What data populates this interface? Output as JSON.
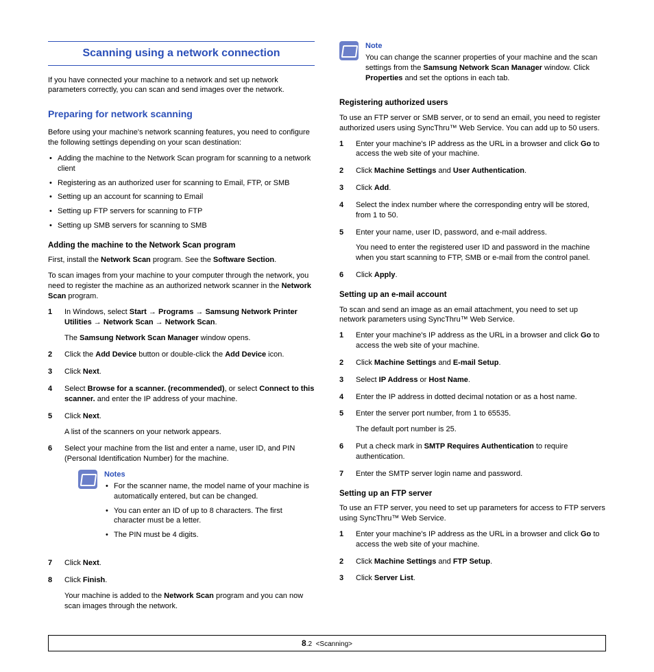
{
  "left": {
    "title": "Scanning using a network connection",
    "intro": "If you have connected your machine to a network and set up network parameters correctly, you can scan and send images over the network.",
    "prep_title": "Preparing for network scanning",
    "prep_intro": "Before using your machine's network scanning features, you need to configure the following settings depending on your scan destination:",
    "prep_bullets": [
      "Adding the machine to the Network Scan program for scanning to a network client",
      "Registering as an authorized user for scanning to Email, FTP, or SMB",
      "Setting up an account for scanning to Email",
      "Setting up FTP servers for scanning to FTP",
      "Setting up SMB servers for scanning to SMB"
    ],
    "add_title": "Adding the machine to the Network Scan program",
    "add_p1_a": "First, install the ",
    "add_p1_b": "Network Scan",
    "add_p1_c": " program. See the ",
    "add_p1_d": "Software Section",
    "add_p1_e": ".",
    "add_p2_a": "To scan images from your machine to your computer through the network, you need to register the machine as an authorized network scanner in the ",
    "add_p2_b": "Network Scan",
    "add_p2_c": " program.",
    "step1_a": "In Windows, select ",
    "step1_b": "Start",
    "step1_c": "Programs",
    "step1_d": "Samsung Network Printer Utilities",
    "step1_e": "Network Scan",
    "step1_f": "Network Scan",
    "step1_g": ".",
    "step1_win_a": "The ",
    "step1_win_b": "Samsung Network Scan Manager",
    "step1_win_c": " window opens.",
    "step2_a": "Click the ",
    "step2_b": "Add Device",
    "step2_c": " button or double-click the ",
    "step2_d": "Add Device",
    "step2_e": " icon.",
    "step3_a": "Click ",
    "step3_b": "Next",
    "step3_c": ".",
    "step4_a": "Select ",
    "step4_b": "Browse for a scanner. (recommended)",
    "step4_c": ", or select ",
    "step4_d": "Connect to this scanner.",
    "step4_e": " and enter the IP address of your machine.",
    "step5_a": "Click ",
    "step5_b": "Next",
    "step5_c": ".",
    "step5_p": "A list of the scanners on your network appears.",
    "step6": "Select your machine from the list and enter a name, user ID, and PIN (Personal Identification Number) for the machine.",
    "notes_title": "Notes",
    "note_b1": "For the scanner name, the model name of your machine is automatically entered, but can be changed.",
    "note_b2": "You can enter an ID of up to 8 characters. The first character must be a letter.",
    "note_b3": "The PIN must be 4 digits.",
    "step7_a": "Click ",
    "step7_b": "Next",
    "step7_c": ".",
    "step8_a": "Click ",
    "step8_b": "Finish",
    "step8_c": ".",
    "step8_p_a": "Your machine is added to the ",
    "step8_p_b": "Network Scan",
    "step8_p_c": " program and you can now scan images through the network."
  },
  "right": {
    "note_title": "Note",
    "note_a": "You can change the scanner properties of your machine and the scan settings from the ",
    "note_b": "Samsung Network Scan Manager",
    "note_c": " window. Click ",
    "note_d": "Properties",
    "note_e": " and set the options in each tab.",
    "reg_title": "Registering authorized users",
    "reg_intro": "To use an FTP server or SMB server, or to send an email, you need to register authorized users using SyncThru™ Web Service. You can add up to 50 users.",
    "r1_a": "Enter your machine's IP address as the URL in a browser and click ",
    "r1_b": "Go",
    "r1_c": " to access the web site of your machine.",
    "r2_a": "Click ",
    "r2_b": "Machine Settings",
    "r2_c": " and ",
    "r2_d": "User Authentication",
    "r2_e": ".",
    "r3_a": "Click ",
    "r3_b": "Add",
    "r3_c": ".",
    "r4": "Select the index number where the corresponding entry will be stored, from 1 to 50.",
    "r5": "Enter your name, user ID, password, and e-mail address.",
    "r5_p": "You need to enter the registered user ID and password in the machine when you start scanning to FTP, SMB or e-mail from the control panel.",
    "r6_a": "Click ",
    "r6_b": "Apply",
    "r6_c": ".",
    "email_title": "Setting up an e-mail account",
    "email_intro": "To scan and send an image as an email attachment, you need to set up network parameters using SyncThru™ Web Service.",
    "e1_a": "Enter your machine's IP address as the URL in a browser and click ",
    "e1_b": "Go",
    "e1_c": " to access the web site of your machine.",
    "e2_a": "Click ",
    "e2_b": "Machine Settings",
    "e2_c": " and ",
    "e2_d": "E-mail Setup",
    "e2_e": ".",
    "e3_a": "Select ",
    "e3_b": "IP Address",
    "e3_c": " or ",
    "e3_d": "Host Name",
    "e3_e": ".",
    "e4": "Enter the IP address in dotted decimal notation or as a host name.",
    "e5": "Enter the server port number, from 1 to 65535.",
    "e5_p": "The default port number is 25.",
    "e6_a": "Put a check mark in ",
    "e6_b": "SMTP Requires Authentication",
    "e6_c": " to require authentication.",
    "e7": "Enter the SMTP server login name and password.",
    "ftp_title": "Setting up an FTP server",
    "ftp_intro": "To use an FTP server, you need to set up parameters for access to FTP servers using SyncThru™ Web Service.",
    "f1_a": "Enter your machine's IP address as the URL in a browser and click ",
    "f1_b": "Go",
    "f1_c": " to access the web site of your machine.",
    "f2_a": "Click ",
    "f2_b": "Machine Settings",
    "f2_c": " and ",
    "f2_d": "FTP Setup",
    "f2_e": ".",
    "f3_a": "Click ",
    "f3_b": "Server List",
    "f3_c": "."
  },
  "footer": {
    "chapter": "8",
    "page": ".2",
    "label": "<Scanning>"
  }
}
